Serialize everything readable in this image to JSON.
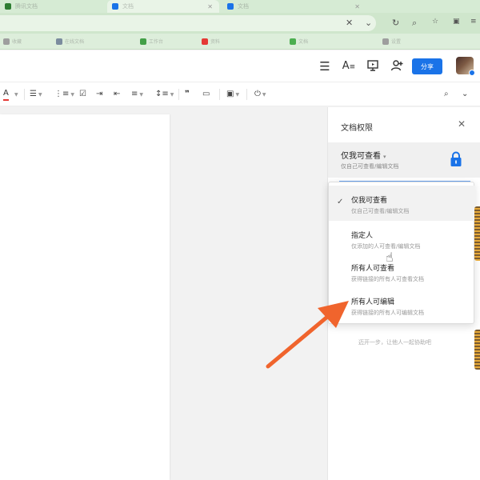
{
  "browser": {
    "tabs": [
      {
        "title": "腾讯文档",
        "color": "#2e7d32"
      },
      {
        "title": "文档",
        "color": "#1a73e8"
      },
      {
        "title": "文档",
        "color": "#1a73e8"
      }
    ],
    "bookmarks": [
      {
        "label": "收藏",
        "color": "#9e9e9e"
      },
      {
        "label": "在线文档",
        "color": "#7b8c9e"
      },
      {
        "label": "工作台",
        "color": "#43a047"
      },
      {
        "label": "资料",
        "color": "#e53935"
      },
      {
        "label": "文档",
        "color": "#4caf50"
      },
      {
        "label": "设置",
        "color": "#9e9e9e"
      }
    ]
  },
  "header": {
    "icons": [
      "menu-icon",
      "font-size-icon",
      "present-icon",
      "add-collaborator-icon"
    ],
    "share_label": "分享"
  },
  "toolbar": {
    "font_color_label": "A",
    "icons": [
      "font-color-icon",
      "bullet-list-icon",
      "numbered-list-icon",
      "checkbox-icon",
      "indent-icon",
      "outdent-icon",
      "align-icon",
      "line-spacing-icon",
      "quote-icon",
      "code-block-icon",
      "insert-image-icon",
      "attachment-icon",
      "search-icon",
      "collapse-icon"
    ]
  },
  "panel": {
    "title": "文档权限",
    "current_permission": "仅我可查看",
    "current_desc": "仅自己可查看/编辑文档",
    "hint": "迈开一步，让他人一起协助吧"
  },
  "dropdown": {
    "options": [
      {
        "title": "仅我可查看",
        "desc": "仅自己可查看/编辑文档",
        "selected": true
      },
      {
        "title": "指定人",
        "desc": "仅添加的人可查看/编辑文档",
        "selected": false
      },
      {
        "title": "所有人可查看",
        "desc": "获得链接的所有人可查看文档",
        "selected": false
      },
      {
        "title": "所有人可编辑",
        "desc": "获得链接的所有人可编辑文档",
        "selected": false
      }
    ]
  },
  "colors": {
    "accent": "#1a73e8",
    "annotation_arrow": "#f0642d"
  }
}
